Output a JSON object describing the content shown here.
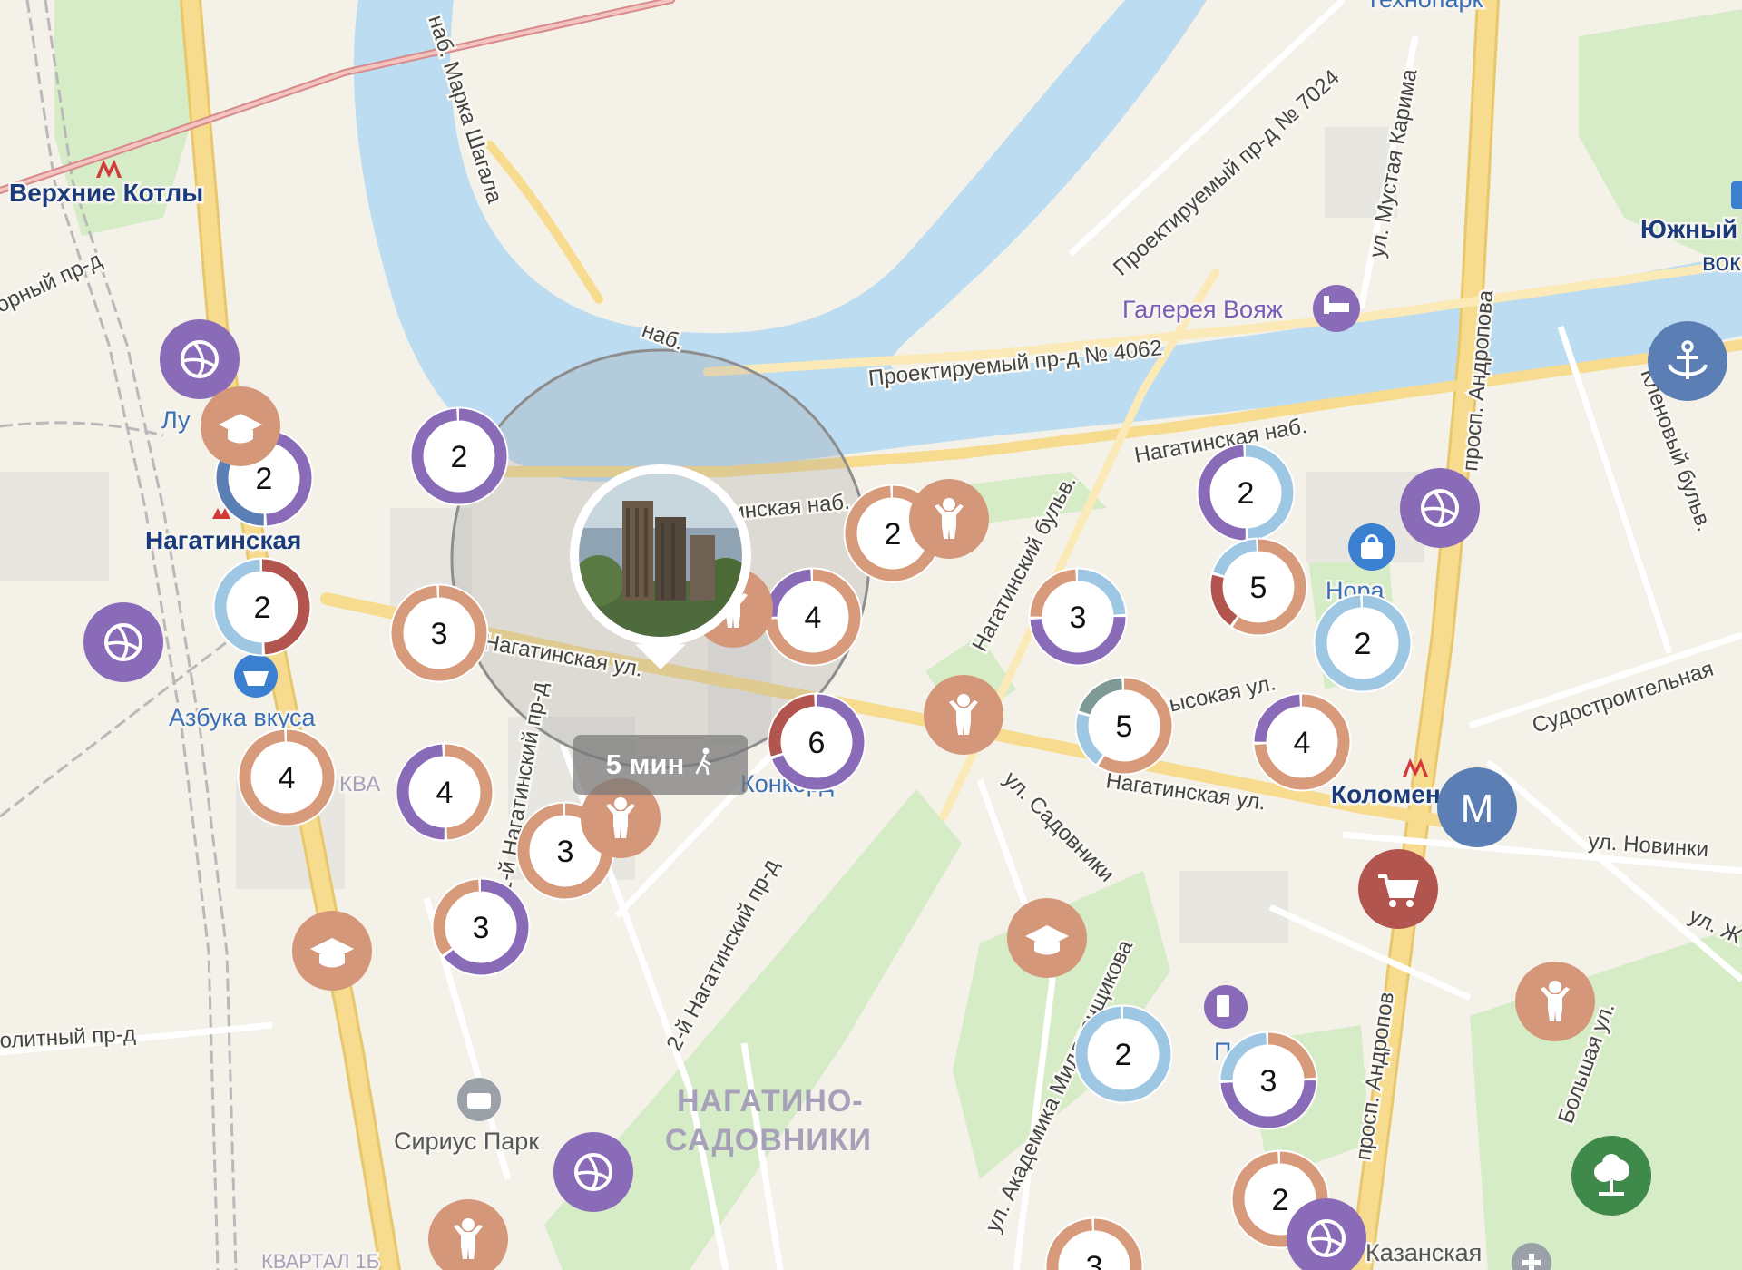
{
  "metro": {
    "verkhnie_kotly": "Верхние Котлы",
    "nagatinskaya": "Нагатинская",
    "kolomenskaya": "Коломен",
    "yuzhny_vokzal_a": "Южный",
    "yuzhny_vokzal_b": "вок",
    "metro_marker": "M"
  },
  "places": {
    "galereya": "Галерея Вояж",
    "azbuka": "Азбука вкуса",
    "nora": "Нора",
    "sirius": "Сириус Парк",
    "kazanskaya": "Казанская",
    "kvartal_1b": "КВАРТАЛ 1Б",
    "konkord": "Конкорд",
    "kva": "КВА",
    "lu": "Лу",
    "technopark": "Технопарк",
    "prom": "Пром"
  },
  "district": {
    "line1": "НАГАТИНО-",
    "line2": "САДОВНИКИ"
  },
  "streets": {
    "marka_shagala": "наб. Марка Шагала",
    "proekt_7024": "Проектируемый пр-д № 7024",
    "mustaya_karima": "ул. Мустая Карима",
    "proekt_4062": "Проектируемый пр-д № 4062",
    "nab_short": "наб.",
    "nagatinskaya_nab": "Нагатинская наб.",
    "nagatinskaya_nab_2": "инская наб.",
    "prosp_andropova": "просп. Андропова",
    "prosp_andropova_2": "просп. Андропов",
    "nagatinsky_bulv": "Нагатинский бульв.",
    "klenovy_bulv": "Кленовый бульв.",
    "nagatinskaya_ul": "Нагатинская ул.",
    "nagatinskaya_ul_2": "Нагатинская ул.",
    "vysokaya": "Высокая ул.",
    "sudostroitelnaya": "Судостроительная",
    "sadovniki": "ул. Садовники",
    "novinki": "ул. Новинки",
    "ul_zh": "ул. Ж",
    "nagatinsky_pr_2": "2-й Нагатинский пр-д",
    "nagatinsky_pr_1": "1-й Нагатинский пр-д",
    "millionshchikova": "ул. Академика Миллионщикова",
    "bolshaya": "Большая ул.",
    "gornyi": "орный пр-д",
    "politny": "олитный пр-д"
  },
  "travel_time": {
    "text": "5 мин",
    "icon": "walking-person-icon"
  },
  "clusters": [
    {
      "id": "c1",
      "count": "2",
      "segments": [
        [
          "#8a6bb8",
          1
        ]
      ]
    },
    {
      "id": "c2",
      "count": "2",
      "segments": [
        [
          "#8a6bb8",
          0.5
        ],
        [
          "#5b7fb5",
          0.5
        ]
      ]
    },
    {
      "id": "c3",
      "count": "2",
      "segments": [
        [
          "#b2554f",
          0.5
        ],
        [
          "#9ec7e4",
          0.5
        ]
      ]
    },
    {
      "id": "c4",
      "count": "3",
      "segments": [
        [
          "#d79a7a",
          1
        ]
      ]
    },
    {
      "id": "c5",
      "count": "4",
      "segments": [
        [
          "#d79a7a",
          1
        ]
      ]
    },
    {
      "id": "c6",
      "count": "4",
      "segments": [
        [
          "#d79a7a",
          0.5
        ],
        [
          "#8a6bb8",
          0.5
        ]
      ]
    },
    {
      "id": "c7",
      "count": "3",
      "segments": [
        [
          "#d79a7a",
          1
        ]
      ]
    },
    {
      "id": "c8",
      "count": "3",
      "segments": [
        [
          "#8a6bb8",
          0.65
        ],
        [
          "#d79a7a",
          0.35
        ]
      ]
    },
    {
      "id": "c9",
      "count": "4",
      "segments": [
        [
          "#d79a7a",
          0.75
        ],
        [
          "#8a6bb8",
          0.25
        ]
      ]
    },
    {
      "id": "c10",
      "count": "6",
      "segments": [
        [
          "#8a6bb8",
          0.7
        ],
        [
          "#b2554f",
          0.3
        ]
      ]
    },
    {
      "id": "c11",
      "count": "2",
      "segments": [
        [
          "#d79a7a",
          1
        ]
      ]
    },
    {
      "id": "c12",
      "count": "3",
      "segments": [
        [
          "#9ec7e4",
          0.25
        ],
        [
          "#8a6bb8",
          0.5
        ],
        [
          "#d79a7a",
          0.25
        ]
      ]
    },
    {
      "id": "c13",
      "count": "2",
      "segments": [
        [
          "#9ec7e4",
          0.5
        ],
        [
          "#8a6bb8",
          0.5
        ]
      ]
    },
    {
      "id": "c14",
      "count": "5",
      "segments": [
        [
          "#d79a7a",
          0.6
        ],
        [
          "#b2554f",
          0.2
        ],
        [
          "#9ec7e4",
          0.2
        ]
      ]
    },
    {
      "id": "c15",
      "count": "2",
      "segments": [
        [
          "#9ec7e4",
          1
        ]
      ]
    },
    {
      "id": "c16",
      "count": "5",
      "segments": [
        [
          "#d79a7a",
          0.6
        ],
        [
          "#9ec7e4",
          0.2
        ],
        [
          "#7f9a96",
          0.2
        ]
      ]
    },
    {
      "id": "c17",
      "count": "4",
      "segments": [
        [
          "#d79a7a",
          0.75
        ],
        [
          "#8a6bb8",
          0.25
        ]
      ]
    },
    {
      "id": "c18",
      "count": "2",
      "segments": [
        [
          "#9ec7e4",
          1
        ]
      ]
    },
    {
      "id": "c19",
      "count": "3",
      "segments": [
        [
          "#d79a7a",
          0.25
        ],
        [
          "#8a6bb8",
          0.5
        ],
        [
          "#9ec7e4",
          0.25
        ]
      ]
    },
    {
      "id": "c20",
      "count": "2",
      "segments": [
        [
          "#d79a7a",
          1
        ]
      ]
    },
    {
      "id": "c21",
      "count": "3",
      "segments": [
        [
          "#d79a7a",
          1
        ]
      ]
    }
  ],
  "poi_icons": [
    {
      "id": "p1",
      "icon": "volleyball-icon",
      "color": "#8a6bb8"
    },
    {
      "id": "p2",
      "icon": "graduation-cap-icon",
      "color": "#d4977a"
    },
    {
      "id": "p3",
      "icon": "volleyball-icon",
      "color": "#8a6bb8"
    },
    {
      "id": "p4",
      "icon": "child-icon",
      "color": "#d4977a"
    },
    {
      "id": "p5",
      "icon": "child-icon",
      "color": "#d4977a"
    },
    {
      "id": "p6",
      "icon": "child-icon",
      "color": "#d4977a"
    },
    {
      "id": "p7",
      "icon": "child-icon",
      "color": "#d4977a"
    },
    {
      "id": "p8",
      "icon": "graduation-cap-icon",
      "color": "#d4977a"
    },
    {
      "id": "p9",
      "icon": "volleyball-icon",
      "color": "#8a6bb8"
    },
    {
      "id": "p10",
      "icon": "anchor-icon",
      "color": "#5b7fb5"
    },
    {
      "id": "p11",
      "icon": "volleyball-icon",
      "color": "#8a6bb8"
    },
    {
      "id": "p12",
      "icon": "metro-icon",
      "color": "#5b7fb5"
    },
    {
      "id": "p13",
      "icon": "shopping-cart-icon",
      "color": "#b2554f"
    },
    {
      "id": "p14",
      "icon": "graduation-cap-icon",
      "color": "#d4977a"
    },
    {
      "id": "p15",
      "icon": "child-icon",
      "color": "#d4977a"
    },
    {
      "id": "p16",
      "icon": "volleyball-icon",
      "color": "#8a6bb8"
    },
    {
      "id": "p17",
      "icon": "child-icon",
      "color": "#d4977a"
    },
    {
      "id": "p18",
      "icon": "tree-icon",
      "color": "#3f8a4a"
    }
  ],
  "colors": {
    "river": "#bcdcf1",
    "park": "#d3ebc4",
    "road_major": "#f7dc8f",
    "background": "#f4f1e9"
  }
}
